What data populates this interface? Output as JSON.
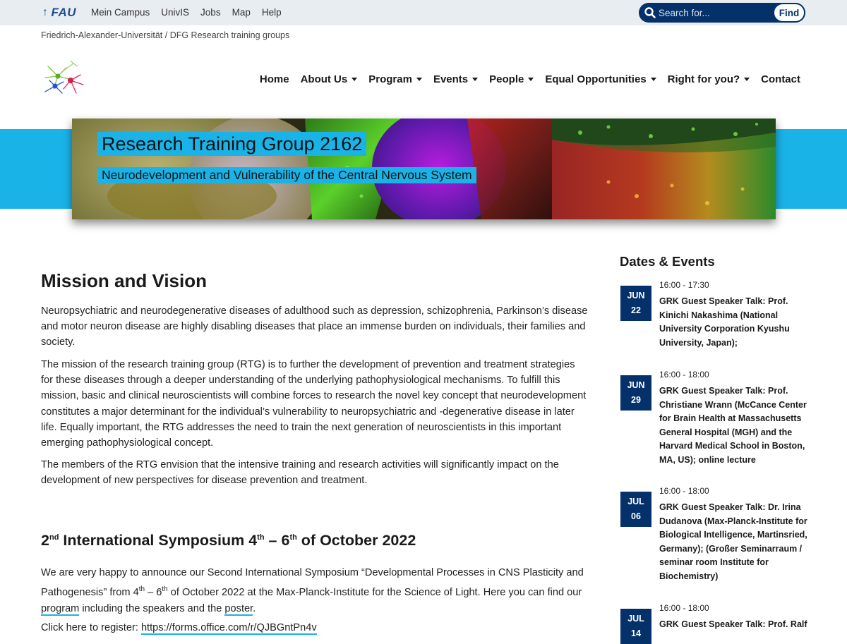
{
  "topbar": {
    "logo_text": "FAU",
    "links": [
      "Mein Campus",
      "UnivIS",
      "Jobs",
      "Map",
      "Help"
    ],
    "search_placeholder": "Search for...",
    "search_button": "Find"
  },
  "breadcrumb": "Friedrich-Alexander-Universität / DFG Research training groups",
  "nav": {
    "items": [
      {
        "label": "Home",
        "dropdown": false
      },
      {
        "label": "About Us",
        "dropdown": true
      },
      {
        "label": "Program",
        "dropdown": true
      },
      {
        "label": "Events",
        "dropdown": true
      },
      {
        "label": "People",
        "dropdown": true
      },
      {
        "label": "Equal Opportunities",
        "dropdown": true
      },
      {
        "label": "Right for you?",
        "dropdown": true
      },
      {
        "label": "Contact",
        "dropdown": false
      }
    ]
  },
  "hero": {
    "title": "Research Training Group 2162",
    "subtitle": "Neurodevelopment and Vulnerability of the Central Nervous System"
  },
  "main": {
    "heading": "Mission and Vision",
    "p1": "Neuropsychiatric and neurodegenerative diseases of adulthood such as depression, schizophrenia, Parkinson’s disease and motor neuron disease are highly disabling diseases that place an immense burden on individuals, their families and society.",
    "p2": "The mission of the research training group (RTG) is to further the development of prevention and treatment strategies for these diseases through a deeper understanding of the underlying pathophysiological mechanisms. To fulfill this mission, basic and clinical neuroscientists will combine forces to research the novel key concept that neurodevelopment constitutes a major determinant for the individual’s vulnerability to neuropsychiatric and -degenerative disease in later life. Equally important, the RTG addresses the need to train the next generation of neuroscientists in this important emerging pathophysiological concept.",
    "p3": "The members of the RTG envision that the intensive training and research activities will significantly impact on the development of new perspectives for disease prevention and treatment.",
    "symposium": {
      "heading_parts": [
        "2",
        "nd",
        " International Symposium 4",
        "th",
        " – 6",
        "th",
        " of October 2022"
      ],
      "text_a": "We are very happy to announce our Second International Symposium “Developmental Processes in CNS Plasticity and Pathogenesis” from 4",
      "sup_a": "th",
      "text_b": " – 6",
      "sup_b": "th",
      "text_c": " of October 2022 at the Max-Planck-Institute for the Science of Light. Here you can find our ",
      "program_link": "program",
      "text_d": " including the speakers and the ",
      "poster_link": "poster",
      "text_e": ".",
      "register_label": "Click here to register: ",
      "register_link": "https://forms.office.com/r/QJBGntPn4v"
    }
  },
  "sidebar": {
    "heading": "Dates & Events",
    "events": [
      {
        "month": "JUN",
        "day": "22",
        "time": "16:00 - 17:30",
        "title": "GRK Guest Speaker Talk: Prof. Kinichi Nakashima (National University Corporation Kyushu University, Japan);"
      },
      {
        "month": "JUN",
        "day": "29",
        "time": "16:00 - 18:00",
        "title": "GRK Guest Speaker Talk: Prof. Christiane Wrann (McCance Center for Brain Health at Massachusetts General Hospital (MGH) and the Harvard Medical School in Boston, MA, US); online lecture"
      },
      {
        "month": "JUL",
        "day": "06",
        "time": "16:00 - 18:00",
        "title": "GRK Guest Speaker Talk: Dr. Irina Dudanova (Max-Planck-Institute for Biological Intelligence, Martinsried, Germany); (Großer Seminarraum / seminar room Institute for Biochemistry)"
      },
      {
        "month": "JUL",
        "day": "14",
        "time": "16:00 - 18:00",
        "title": "GRK Guest Speaker Talk: Prof. Ralf"
      }
    ]
  },
  "colors": {
    "accent_cyan": "#1ab3e8",
    "navy": "#04316a",
    "topbar_bg": "#e8edf2"
  }
}
